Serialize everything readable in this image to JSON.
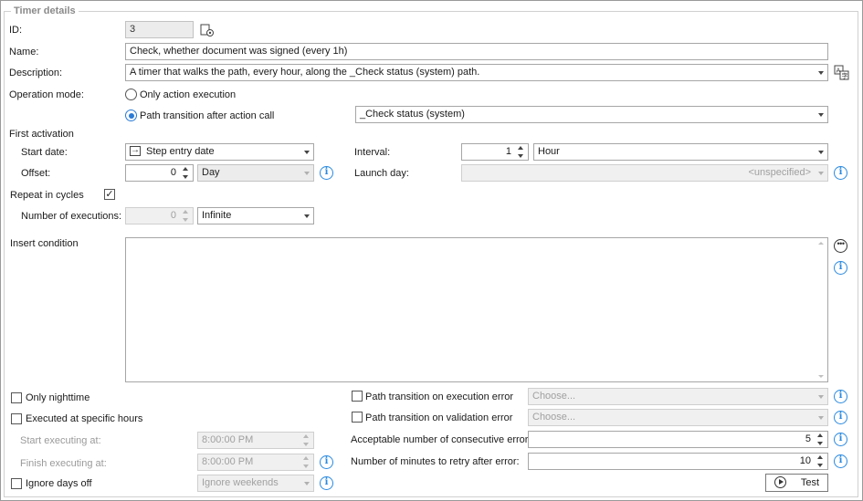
{
  "section": {
    "title": "Timer details"
  },
  "id_field": {
    "label": "ID:",
    "value": "3",
    "icon": "id-settings-icon"
  },
  "name_field": {
    "label": "Name:",
    "value": "Check, whether document was signed (every 1h)"
  },
  "description_field": {
    "label": "Description:",
    "value": "A timer that walks the path, every hour, along the _Check status (system) path.",
    "icon": "translations-icon"
  },
  "operation_mode": {
    "label": "Operation mode:",
    "options": [
      {
        "label": "Only action execution",
        "selected": false
      },
      {
        "label": "Path transition after action call",
        "selected": true
      }
    ],
    "path_value": "_Check status (system)"
  },
  "first_activation": {
    "label": "First activation",
    "start_date_label": "Start date:",
    "start_date_value": "Step entry date",
    "interval_label": "Interval:",
    "interval_value": "1",
    "interval_unit": "Hour",
    "offset_label": "Offset:",
    "offset_value": "0",
    "offset_unit": "Day",
    "launch_day_label": "Launch day:",
    "launch_day_value": "<unspecified>"
  },
  "repeat": {
    "label": "Repeat in cycles",
    "checked": true,
    "executions_label": "Number of executions:",
    "executions_value": "0",
    "executions_mode": "Infinite"
  },
  "condition": {
    "label": "Insert condition",
    "value": ""
  },
  "bottom_left": {
    "only_nighttime": {
      "label": "Only nighttime",
      "checked": false
    },
    "specific_hours": {
      "label": "Executed at specific hours",
      "checked": false
    },
    "start_label": "Start executing at:",
    "start_value": "8:00:00 PM",
    "finish_label": "Finish executing at:",
    "finish_value": "8:00:00 PM",
    "ignore_days_off": {
      "label": "Ignore days off",
      "checked": false
    },
    "ignore_value": "Ignore weekends"
  },
  "bottom_right": {
    "exec_error": {
      "label": "Path transition on execution error",
      "checked": false,
      "placeholder": "Choose..."
    },
    "valid_error": {
      "label": "Path transition on validation error",
      "checked": false,
      "placeholder": "Choose..."
    },
    "consecutive_label": "Acceptable number of consecutive errors:",
    "consecutive_value": "5",
    "retry_label": "Number of minutes to retry after error:",
    "retry_value": "10",
    "test_button": "Test"
  },
  "colors": {
    "accent": "#2a8ae0",
    "radio_accent": "#2a7bd6",
    "border": "#a6a6a6"
  }
}
